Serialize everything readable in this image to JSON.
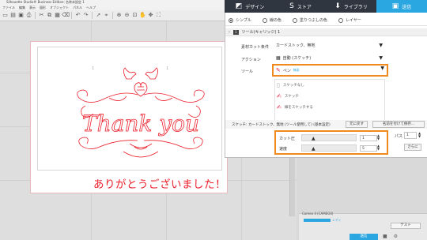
{
  "window": {
    "title": "Silhouette Studio® Business Edition: 名称未設定 1",
    "menu": [
      "ファイル",
      "編集",
      "表示",
      "図形",
      "オブジェクト",
      "パネル",
      "ヘルプ"
    ]
  },
  "toolbar": {
    "icons": [
      "new-icon",
      "open-icon",
      "save-icon",
      "print-icon",
      "cut-icon",
      "copy-icon",
      "paste-icon",
      "delete-icon",
      "undo-icon",
      "redo-icon",
      "select-icon",
      "point-edit-icon",
      "zoom-in-icon",
      "zoom-out-icon",
      "zoom-fit-icon",
      "pan-icon",
      "move-icon",
      "fullscreen-icon"
    ]
  },
  "nav": {
    "items": [
      {
        "label": "デザイン",
        "icon": "design-icon",
        "active": false
      },
      {
        "label": "ストア",
        "icon": "store-icon",
        "active": false
      },
      {
        "label": "ライブラリ",
        "icon": "library-icon",
        "active": false
      },
      {
        "label": "送信",
        "icon": "send-icon",
        "active": true
      }
    ],
    "active_color": "#2aa6e0"
  },
  "panel": {
    "modes": {
      "simple": "シンプル",
      "line": "線の色",
      "fill": "塗りつぶしの色",
      "layer": "レイヤー"
    },
    "tool_header": {
      "badge": "1",
      "label": "ツール(キャリッジ) 1"
    },
    "material": {
      "label": "素材カット条件",
      "value": "カードストック、無地"
    },
    "action": {
      "label": "アクション",
      "value": "自動 (スケッチ)"
    },
    "tool": {
      "label": "ツール",
      "value": "ペン",
      "value_tag": "無彩"
    },
    "tool_options": [
      "スケッチなし",
      "スケッチ",
      "線をスケッチする"
    ],
    "condition_text": "スケッチ: カードストック、無地 (ツール使用して) (基本設定)",
    "reset_label": "元に戻す",
    "save_label": "名前を付けて保存...",
    "force": {
      "label": "カット圧",
      "value": "1"
    },
    "speed": {
      "label": "速度",
      "value": "5"
    },
    "pass": {
      "label": "パス",
      "value": "1"
    },
    "advanced_label": "さらに",
    "highlight_color": "#f08a1e"
  },
  "canvas": {
    "mat_numbers": [
      "1",
      "1"
    ],
    "thank_you": "Thank you",
    "message": "ありがとうございました！",
    "ink_color": "#ec1f2b"
  },
  "send": {
    "device_label": "Cameo 4 (CAMEO4)",
    "progress_label": "レディ",
    "send_label": "送信",
    "test_label": "テスト",
    "progress": 0.2
  }
}
